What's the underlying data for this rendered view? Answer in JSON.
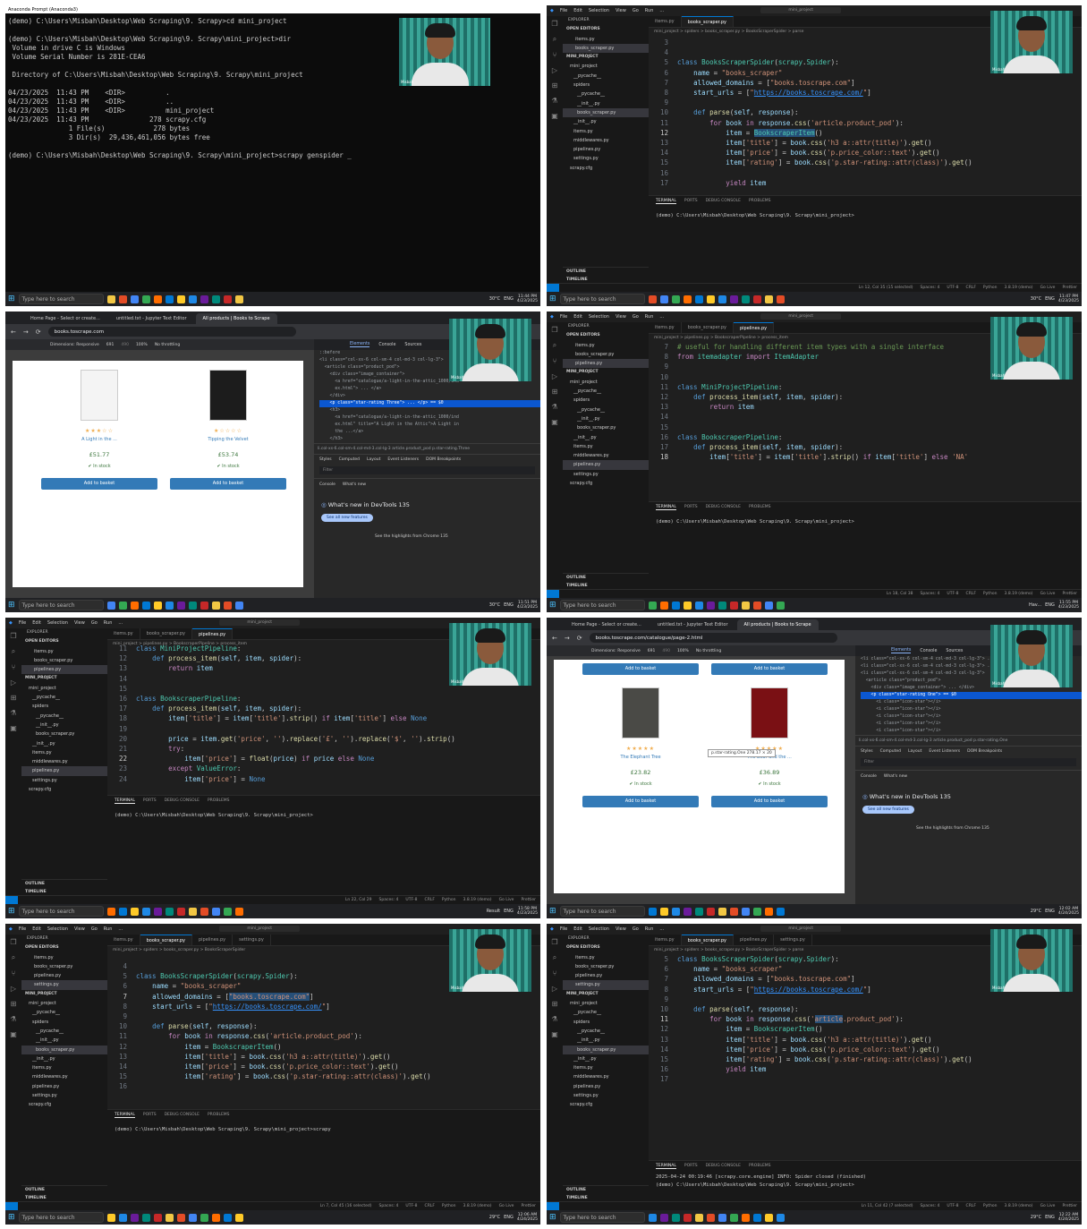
{
  "taskbar": {
    "search_placeholder": "Type here to search",
    "lang": "ENG",
    "clocks": [
      {
        "time": "11:44 PM",
        "date": "4/23/2025",
        "temp": "30°C"
      },
      {
        "time": "11:47 PM",
        "date": "4/23/2025",
        "temp": "30°C"
      },
      {
        "time": "11:51 PM",
        "date": "4/23/2025",
        "temp": "30°C"
      },
      {
        "time": "11:55 PM",
        "date": "4/23/2025",
        "temp": "Hav..."
      },
      {
        "time": "11:58 PM",
        "date": "4/23/2025",
        "temp": "Result"
      },
      {
        "time": "12:02 AM",
        "date": "4/24/2025",
        "temp": "29°C"
      },
      {
        "time": "12:06 AM",
        "date": "4/24/2025",
        "temp": "29°C"
      },
      {
        "time": "12:22 AM",
        "date": "4/24/2025",
        "temp": "29°C"
      }
    ]
  },
  "webcam_name": "Misbah",
  "t1": {
    "title": "Anaconda Prompt (Anaconda3)",
    "lines": [
      "(demo) C:\\Users\\Misbah\\Desktop\\Web Scraping\\9. Scrapy>cd mini_project",
      "",
      "(demo) C:\\Users\\Misbah\\Desktop\\Web Scraping\\9. Scrapy\\mini_project>dir",
      " Volume in drive C is Windows",
      " Volume Serial Number is 281E-CEA6",
      "",
      " Directory of C:\\Users\\Misbah\\Desktop\\Web Scraping\\9. Scrapy\\mini_project",
      "",
      "04/23/2025  11:43 PM    <DIR>          .",
      "04/23/2025  11:43 PM    <DIR>          ..",
      "04/23/2025  11:43 PM    <DIR>          mini_project",
      "04/23/2025  11:43 PM               278 scrapy.cfg",
      "               1 File(s)            278 bytes",
      "               3 Dir(s)  29,436,461,056 bytes free",
      "",
      "(demo) C:\\Users\\Misbah\\Desktop\\Web Scraping\\9. Scrapy\\mini_project>scrapy genspider _"
    ]
  },
  "vscode": {
    "menu": [
      "File",
      "Edit",
      "Selection",
      "View",
      "Go",
      "Run",
      "..."
    ],
    "search": "mini_project",
    "explorer_label": "EXPLORER",
    "open_editors": "OPEN EDITORS",
    "project": "MINI_PROJECT",
    "outline": "OUTLINE",
    "timeline": "TIMELINE",
    "terminal_tabs": [
      "TERMINAL",
      "PORTS",
      "DEBUG CONSOLE",
      "PROBLEMS"
    ],
    "prompt": "(demo) C:\\Users\\Misbah\\Desktop\\Web Scraping\\9. Scrapy\\mini_project>",
    "status_items": [
      "Spaces: 4",
      "UTF-8",
      "CRLF",
      "Python",
      "3.8.19 (demo)",
      "Go Live",
      "Prettier"
    ]
  },
  "t2": {
    "tabs": [
      "items.py",
      "books_scraper.py"
    ],
    "breadcrumb": "mini_project > spiders > books_scraper.py > BooksScraperSpider > parse",
    "sidebar": [
      "items.py  mini_project",
      "books_scraper.py  mi...",
      "mini_project",
      "__pycache__",
      "spiders",
      "__pycache__",
      "__init__.py",
      "books_scraper.py",
      "__init__.py",
      "items.py",
      "middlewares.py",
      "pipelines.py",
      "settings.py",
      "scrapy.cfg"
    ],
    "status_pos": "Ln 12, Col 35 (15 selected)",
    "term_line": "(demo) C:\\Users\\Misbah\\Desktop\\Web Scraping\\9. Scrapy\\mini_project>"
  },
  "t3": {
    "tabs": [
      "Home Page - Select or create...",
      "untitled.txt - Jupyter Text Editor",
      "All products | Books to Scrape"
    ],
    "url": "books.toscrape.com",
    "dims": "Dimensions: Responsive",
    "width": "691",
    "height": "490",
    "zoom": "100%",
    "throttle": "No throttling",
    "dev_tabs": [
      "Elements",
      "Console",
      "Sources"
    ],
    "products": [
      {
        "title": "A Light in the ...",
        "price": "£51.77",
        "stock": "In stock",
        "stars": "★★★☆☆",
        "cover": "#f4f4f4"
      },
      {
        "title": "Tipping the Velvet",
        "price": "£53.74",
        "stock": "In stock",
        "stars": "★☆☆☆☆",
        "cover": "#1c1c1c"
      }
    ],
    "basket": "Add to basket",
    "dom": [
      "::before",
      "<li class=\"col-xs-6 col-sm-4 col-md-3 col-lg-3\">",
      "  <article class=\"product_pod\">",
      "    <div class=\"image_container\">",
      "      <a href=\"catalogue/a-light-in-the-attic_1000/ind",
      "      ex.html\"> ... </a>",
      "    </div>",
      "    <p class=\"star-rating Three\"> ... </p> == $0",
      "    <h3>",
      "      <a href=\"catalogue/a-light-in-the-attic_1000/ind",
      "      ex.html\" title=\"A Light in the Attic\">A Light in",
      "      the ...</a>",
      "    </h3>"
    ],
    "crumb": "li.col-xs-6.col-sm-4.col-md-3.col-lg-3   article.product_pod   p.star-rating.Three",
    "styles_tabs": [
      "Styles",
      "Computed",
      "Layout",
      "Event Listeners",
      "DOM Breakpoints"
    ],
    "filter": "Filter",
    "console_tabs": [
      "Console",
      "What's new"
    ],
    "whats_new": "What's new in DevTools 135",
    "see_all": "See all new features",
    "highlights": "See the highlights from Chrome 135"
  },
  "t4": {
    "tabs": [
      "items.py",
      "books_scraper.py",
      "pipelines.py"
    ],
    "breadcrumb": "mini_project > pipelines.py > BookscraperPipeline > process_item",
    "status_pos": "Ln 18, Col 38"
  },
  "t5": {
    "tabs": [
      "items.py",
      "books_scraper.py",
      "pipelines.py"
    ],
    "breadcrumb": "mini_project > pipelines.py > BookscraperPipeline > process_item",
    "status_pos": "Ln 22, Col 29"
  },
  "t6": {
    "url": "books.toscrape.com/catalogue/page-2.html",
    "products": [
      {
        "title": "The Elephant Tree",
        "price": "£23.82",
        "stock": "In stock",
        "stars": "★★★★★",
        "cover": "#4a4a46"
      },
      {
        "title": "The Bear and the ...",
        "price": "£36.89",
        "stock": "In stock",
        "stars": "★★★★★",
        "cover": "#7a1014"
      }
    ],
    "tooltip": "p.star-rating.One  278.17 × 20",
    "dom": [
      "<li class=\"col-xs-6 col-sm-4 col-md-3 col-lg-3\"> ... </li>",
      "<li class=\"col-xs-6 col-sm-4 col-md-3 col-lg-3\"> ... </li>",
      "<li class=\"col-xs-6 col-sm-4 col-md-3 col-lg-3\">",
      "  <article class=\"product_pod\">",
      "    <div class=\"image_container\"> ... </div>",
      "    <p class=\"star-rating One\"> == $0",
      "      <i class=\"icon-star\"></i>",
      "      <i class=\"icon-star\"></i>",
      "      <i class=\"icon-star\"></i>",
      "      <i class=\"icon-star\"></i>",
      "      <i class=\"icon-star\"></i>"
    ],
    "crumb": "li.col-xs-6.col-sm-4.col-md-3.col-lg-3   article.product_pod   p.star-rating.One"
  },
  "t7": {
    "tabs": [
      "items.py",
      "books_scraper.py",
      "pipelines.py",
      "settings.py"
    ],
    "breadcrumb": "mini_project > spiders > books_scraper.py > BooksScraperSpider",
    "status_pos": "Ln 7, Col 45 (16 selected)",
    "term_line": "(demo) C:\\Users\\Misbah\\Desktop\\Web Scraping\\9. Scrapy\\mini_project>scrapy"
  },
  "t8": {
    "tabs": [
      "items.py",
      "books_scraper.py",
      "pipelines.py",
      "settings.py"
    ],
    "breadcrumb": "mini_project > spiders > books_scraper.py > BooksScraperSpider > parse",
    "status_pos": "Ln 11, Col 42 (7 selected)",
    "term_line1": "2025-04-24 00:19:46 [scrapy.core.engine] INFO: Spider closed (finished)",
    "term_line2": "(demo) C:\\Users\\Misbah\\Desktop\\Web Scraping\\9. Scrapy\\mini_project>"
  }
}
